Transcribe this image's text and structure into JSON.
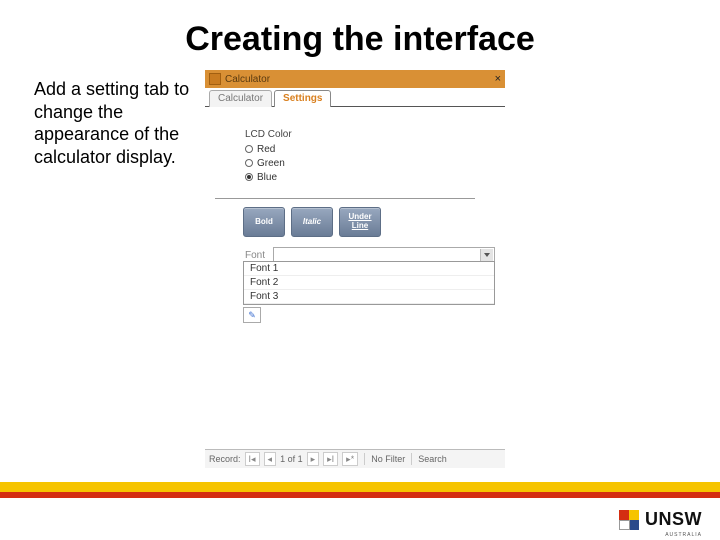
{
  "slide": {
    "title": "Creating the interface",
    "body_text": "Add a setting tab to change the appearance of the calculator display."
  },
  "app": {
    "window_title": "Calculator",
    "close_glyph": "×",
    "tabs": [
      {
        "label": "Calculator",
        "active": false
      },
      {
        "label": "Settings",
        "active": true
      }
    ],
    "color_group_label": "LCD Color",
    "colors": [
      {
        "label": "Red",
        "selected": false
      },
      {
        "label": "Green",
        "selected": false
      },
      {
        "label": "Blue",
        "selected": true
      }
    ],
    "style_buttons": {
      "bold": "Bold",
      "italic": "Italic",
      "underline": "Under\nLine"
    },
    "font_label": "Font",
    "font_options": [
      "Font 1",
      "Font 2",
      "Font 3"
    ],
    "statusbar": {
      "record_label": "Record:",
      "first": "I◂",
      "prev": "◂",
      "position": "1 of 1",
      "next": "▸",
      "last": "▸I",
      "new": "▸*",
      "no_filter": "No Filter",
      "search": "Search"
    }
  },
  "branding": {
    "name": "UNSW",
    "sub": "AUSTRALIA"
  }
}
